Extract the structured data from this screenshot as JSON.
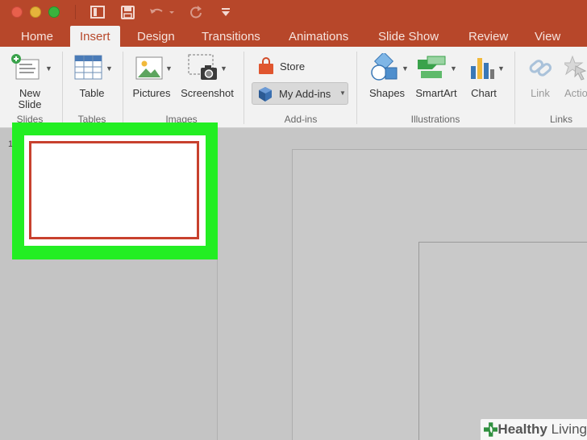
{
  "titlebar": {
    "quick_access": [
      "sidebar-icon",
      "save-icon",
      "undo-icon",
      "redo-icon",
      "customize-icon"
    ]
  },
  "tabs": {
    "home": "Home",
    "insert": "Insert",
    "design": "Design",
    "transitions": "Transitions",
    "animations": "Animations",
    "slideshow": "Slide Show",
    "review": "Review",
    "view": "View"
  },
  "ribbon": {
    "new_slide": "New\nSlide",
    "new_slide_l1": "New",
    "new_slide_l2": "Slide",
    "table": "Table",
    "pictures": "Pictures",
    "screenshot": "Screenshot",
    "store": "Store",
    "my_addins": "My Add-ins",
    "shapes": "Shapes",
    "smartart": "SmartArt",
    "chart": "Chart",
    "link": "Link",
    "action": "Actio",
    "groups": {
      "slides": "Slides",
      "tables": "Tables",
      "images": "Images",
      "addins": "Add-ins",
      "illustrations": "Illustrations",
      "links": "Links"
    }
  },
  "thumbnails": {
    "slide_number": "1"
  },
  "watermark": {
    "brand_bold": "Healthy",
    "brand_light": "Living"
  },
  "colors": {
    "accent": "#b7472a",
    "highlight": "#23ee23",
    "thumb_border": "#c8412e"
  }
}
